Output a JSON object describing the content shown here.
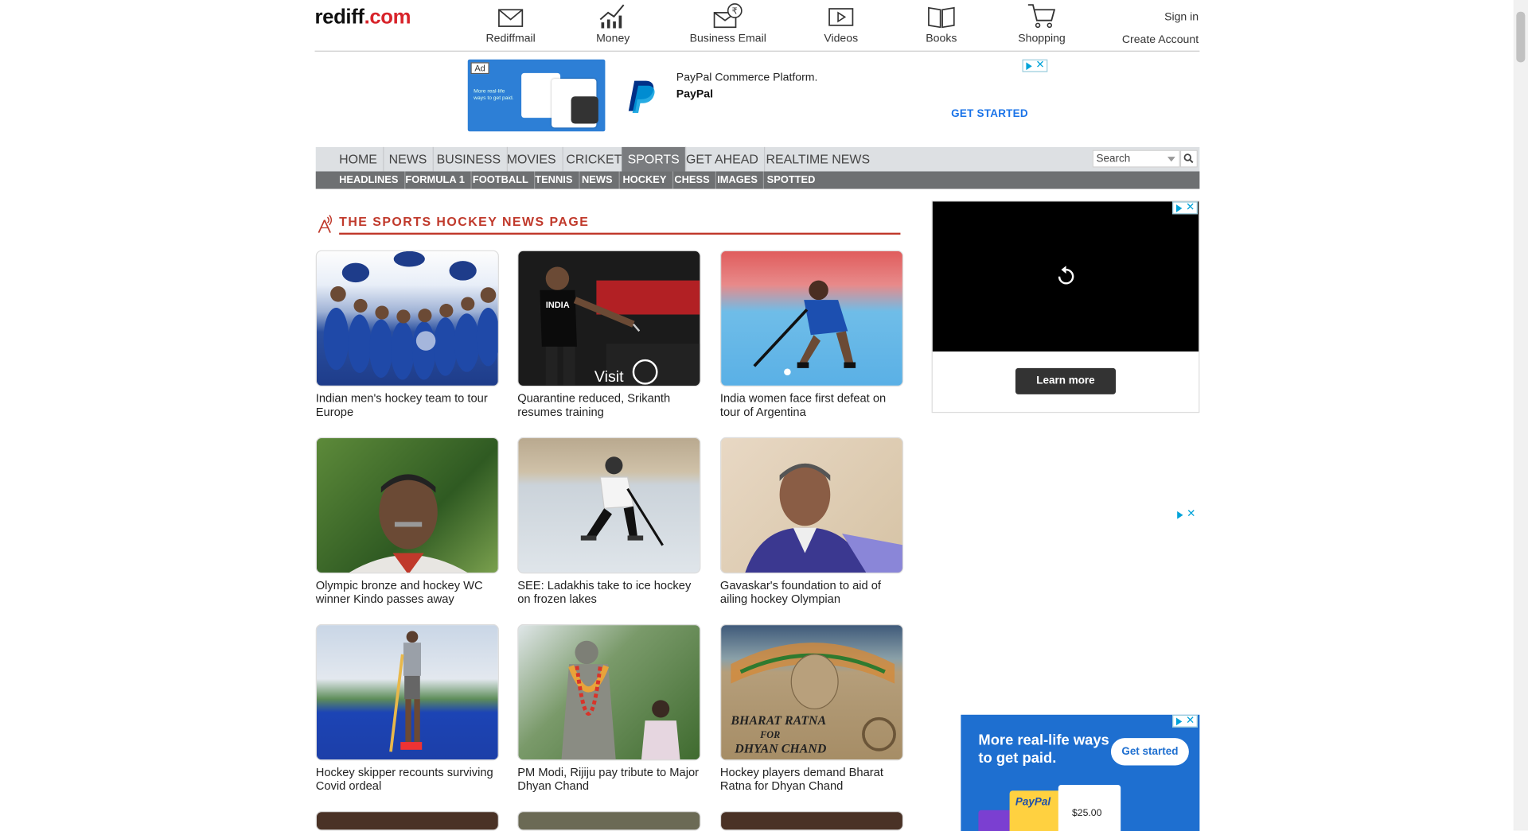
{
  "site": {
    "logo_text": "rediff",
    "logo_dot": ".com"
  },
  "topnav": [
    {
      "label": "Rediffmail",
      "icon": "mail-icon"
    },
    {
      "label": "Money",
      "icon": "chart-icon"
    },
    {
      "label": "Business Email",
      "icon": "business-email-icon"
    },
    {
      "label": "Videos",
      "icon": "video-icon"
    },
    {
      "label": "Books",
      "icon": "book-icon"
    },
    {
      "label": "Shopping",
      "icon": "cart-icon"
    }
  ],
  "account": {
    "signin": "Sign in",
    "create": "Create Account"
  },
  "top_ad": {
    "badge": "Ad",
    "title": "PayPal Commerce Platform.",
    "brand": "PayPal",
    "cta": "GET STARTED",
    "image_text": "More real-life ways to get paid."
  },
  "mainnav": [
    "HOME",
    "NEWS",
    "BUSINESS",
    "MOVIES",
    "CRICKET",
    "SPORTS",
    "GET AHEAD",
    "REALTIME NEWS"
  ],
  "mainnav_active": "SPORTS",
  "search": {
    "placeholder": "Search"
  },
  "subnav": [
    "HEADLINES",
    "FORMULA 1",
    "FOOTBALL",
    "TENNIS",
    "NEWS",
    "HOCKEY",
    "CHESS",
    "IMAGES",
    "SPOTTED"
  ],
  "subnav_active": "HOCKEY",
  "section_title": "THE SPORTS HOCKEY NEWS PAGE",
  "stories": [
    {
      "caption": "Indian men's hockey team to tour Europe"
    },
    {
      "caption": "Quarantine reduced, Srikanth resumes training"
    },
    {
      "caption": "India women face first defeat on tour of Argentina"
    },
    {
      "caption": "Olympic bronze and hockey WC winner Kindo passes away"
    },
    {
      "caption": "SEE: Ladakhis take to ice hockey on frozen lakes"
    },
    {
      "caption": "Gavaskar's foundation to aid of ailing hockey Olympian"
    },
    {
      "caption": "Hockey skipper recounts surviving Covid ordeal"
    },
    {
      "caption": "PM Modi, Rijiju pay tribute to Major Dhyan Chand"
    },
    {
      "caption": "Hockey players demand Bharat Ratna for Dhyan Chand"
    }
  ],
  "story_images": {
    "sandart_line1": "BHARAT RATNA",
    "sandart_line2": "FOR",
    "sandart_line3": "DHYAN CHAND",
    "badminton_visit": "Visit",
    "badminton_shirt": "INDIA"
  },
  "right_ad1": {
    "learn_more": "Learn more"
  },
  "right_ad2": {
    "headline": "More real-life ways to get paid.",
    "cta": "Get started",
    "brand": "PayPal",
    "amount": "$25.00"
  },
  "colors": {
    "accent": "#c0392b",
    "nav_active": "#7a7c7f",
    "subnav_bg": "#6e7072",
    "ad_blue": "#1e6fd0"
  }
}
